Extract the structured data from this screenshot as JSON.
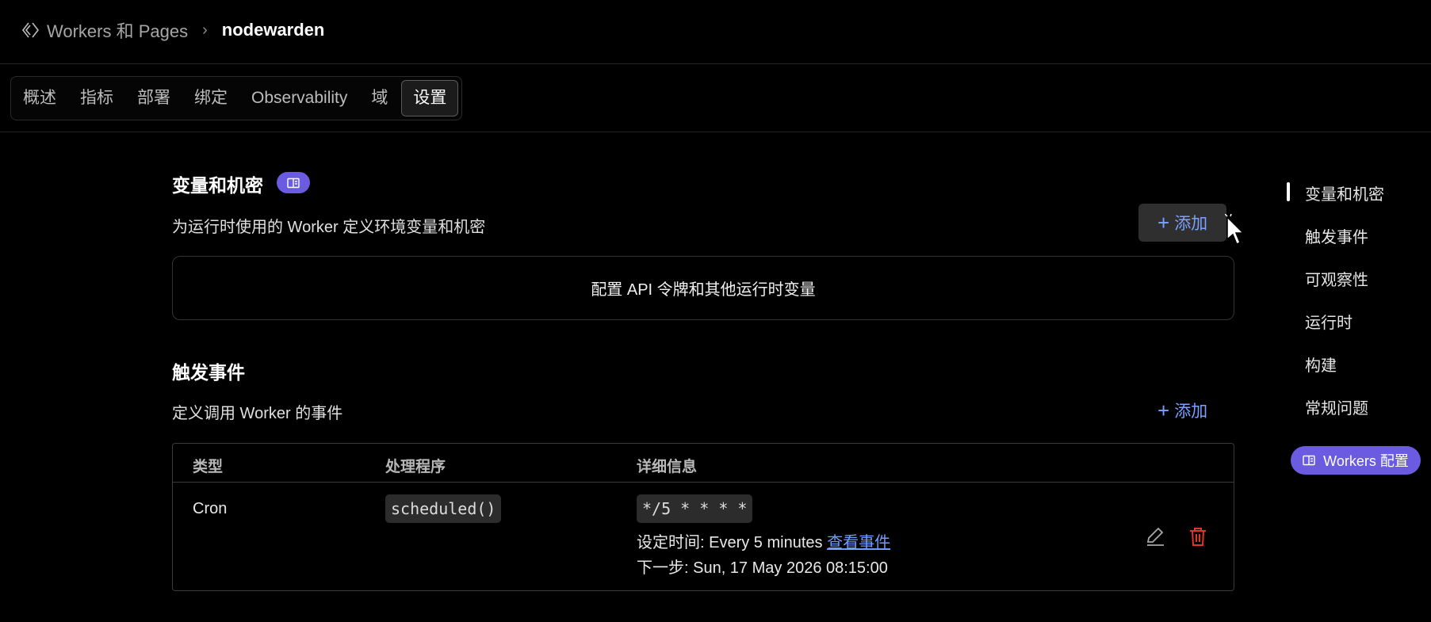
{
  "breadcrumb": {
    "root": "Workers 和 Pages",
    "separator": "›",
    "current": "nodewarden"
  },
  "tabs": [
    {
      "label": "概述"
    },
    {
      "label": "指标"
    },
    {
      "label": "部署"
    },
    {
      "label": "绑定"
    },
    {
      "label": "Observability"
    },
    {
      "label": "域"
    },
    {
      "label": "设置",
      "active": true
    }
  ],
  "variables": {
    "title": "变量和机密",
    "description": "为运行时使用的 Worker 定义环境变量和机密",
    "add_label": "添加",
    "empty_text": "配置 API 令牌和其他运行时变量"
  },
  "triggers": {
    "title": "触发事件",
    "description": "定义调用 Worker 的事件",
    "add_label": "添加",
    "columns": [
      "类型",
      "处理程序",
      "详细信息"
    ],
    "rows": [
      {
        "type": "Cron",
        "handler": "scheduled()",
        "cron": "*/5 * * * *",
        "schedule_prefix": "设定时间: Every 5 minutes",
        "view_events": "查看事件",
        "next_run": "下一步: Sun, 17 May 2026 08:15:00"
      }
    ]
  },
  "toc": {
    "items": [
      "变量和机密",
      "触发事件",
      "可观察性",
      "运行时",
      "构建",
      "常规问题"
    ],
    "active_index": 0
  },
  "workers_config_label": "Workers 配置",
  "colors": {
    "accent": "#6a5be0",
    "link": "#6f9cff",
    "danger": "#e5332a"
  },
  "icons": [
    "workers-diamond-icon",
    "book-icon",
    "plus-icon",
    "edit-pencil-icon",
    "trash-icon",
    "pointer-cursor-icon"
  ]
}
